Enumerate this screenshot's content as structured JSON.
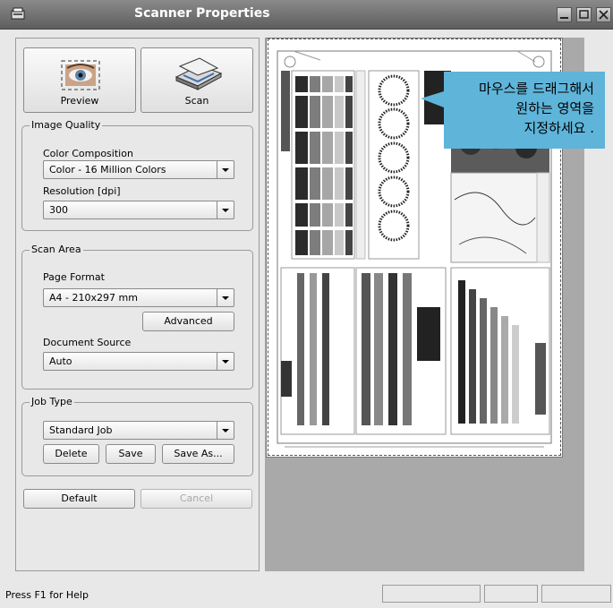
{
  "window": {
    "title": "Scanner Properties",
    "controls": [
      "minimize",
      "maximize",
      "close"
    ]
  },
  "toolbar": {
    "preview_label": "Preview",
    "scan_label": "Scan"
  },
  "image_quality": {
    "legend": "Image Quality",
    "color_label": "Color Composition",
    "color_value": "Color - 16 Million Colors",
    "resolution_label": "Resolution [dpi]",
    "resolution_value": "300"
  },
  "scan_area": {
    "legend": "Scan Area",
    "page_format_label": "Page Format",
    "page_format_value": "A4 - 210x297 mm",
    "advanced_label": "Advanced",
    "document_source_label": "Document Source",
    "document_source_value": "Auto"
  },
  "job_type": {
    "legend": "Job Type",
    "value": "Standard Job",
    "delete_label": "Delete",
    "save_label": "Save",
    "save_as_label": "Save As..."
  },
  "actions": {
    "default_label": "Default",
    "cancel_label": "Cancel"
  },
  "tooltip": {
    "line1": "마우스를 드래그해서",
    "line2": "원하는 영역을",
    "line3": "지정하세요 ."
  },
  "status": {
    "help_text": "Press F1 for Help"
  },
  "colors": {
    "titlebar": "#5e5e5e",
    "tooltip_bg": "#5fb4d9",
    "preview_bg": "#a9a9a9"
  }
}
